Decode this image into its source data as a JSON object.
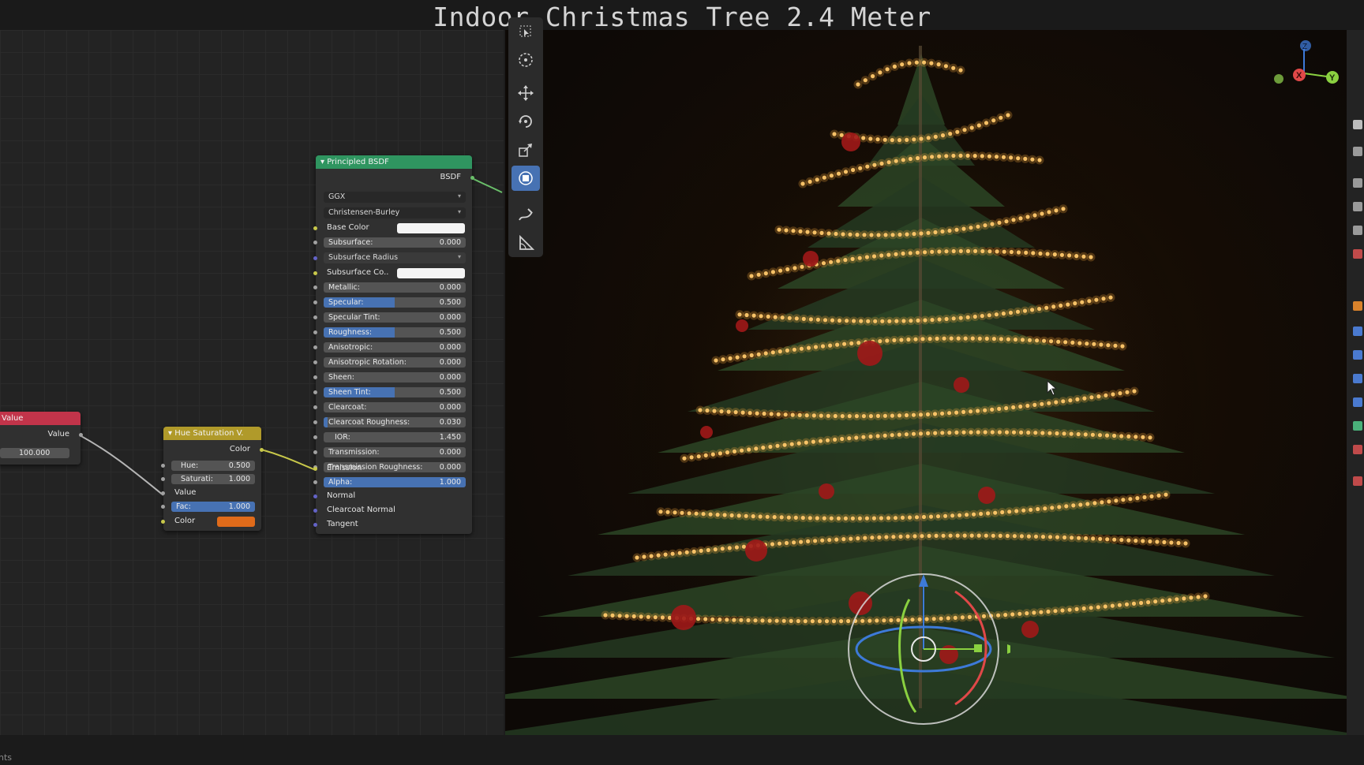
{
  "title": "Indoor Christmas Tree 2.4 Meter",
  "status_text": "hts",
  "colors": {
    "accent": "#4772b3",
    "bsdf_header": "#2f9560",
    "value_header": "#c2344a",
    "hue_header": "#b09a2a",
    "emission_color": "#e06b1a"
  },
  "value_node": {
    "header": "Value",
    "output": "Value",
    "field": "100.000"
  },
  "hue_node": {
    "header": "Hue Saturation V.",
    "output": "Color",
    "hue_label": "Hue:",
    "hue_value": "0.500",
    "sat_label": "Saturati:",
    "sat_value": "1.000",
    "value_label": "Value",
    "fac_label": "Fac:",
    "fac_value": "1.000",
    "fac_fill": 1.0,
    "color_label": "Color"
  },
  "bsdf_node": {
    "header": "Principled BSDF",
    "output": "BSDF",
    "distribution": "GGX",
    "subsurface_method": "Christensen-Burley",
    "base_color_label": "Base Color",
    "subsurface_radius_label": "Subsurface Radius",
    "subsurface_color_label": "Subsurface Co..",
    "fields": [
      {
        "label": "Subsurface:",
        "value": "0.000",
        "fill": 0
      },
      {
        "label": "Metallic:",
        "value": "0.000",
        "fill": 0
      },
      {
        "label": "Specular:",
        "value": "0.500",
        "fill": 0.5
      },
      {
        "label": "Specular Tint:",
        "value": "0.000",
        "fill": 0
      },
      {
        "label": "Roughness:",
        "value": "0.500",
        "fill": 0.5
      },
      {
        "label": "Anisotropic:",
        "value": "0.000",
        "fill": 0
      },
      {
        "label": "Anisotropic Rotation:",
        "value": "0.000",
        "fill": 0
      },
      {
        "label": "Sheen:",
        "value": "0.000",
        "fill": 0
      },
      {
        "label": "Sheen Tint:",
        "value": "0.500",
        "fill": 0.5
      },
      {
        "label": "Clearcoat:",
        "value": "0.000",
        "fill": 0
      },
      {
        "label": "Clearcoat Roughness:",
        "value": "0.030",
        "fill": 0.03
      },
      {
        "label": "IOR:",
        "value": "1.450",
        "fill": 0
      },
      {
        "label": "Transmission:",
        "value": "0.000",
        "fill": 0
      },
      {
        "label": "Transmission Roughness:",
        "value": "0.000",
        "fill": 0
      },
      {
        "label": "Alpha:",
        "value": "1.000",
        "fill": 1.0
      }
    ],
    "emission_label": "Emission",
    "normal_label": "Normal",
    "clearcoat_normal_label": "Clearcoat Normal",
    "tangent_label": "Tangent"
  },
  "toolbar": {
    "tools": [
      "select-box",
      "cursor",
      "move",
      "rotate",
      "scale",
      "transform",
      "annotate",
      "measure"
    ],
    "active": "transform"
  },
  "axis_gizmo": {
    "x": "X",
    "y": "Y",
    "z": "Z"
  }
}
